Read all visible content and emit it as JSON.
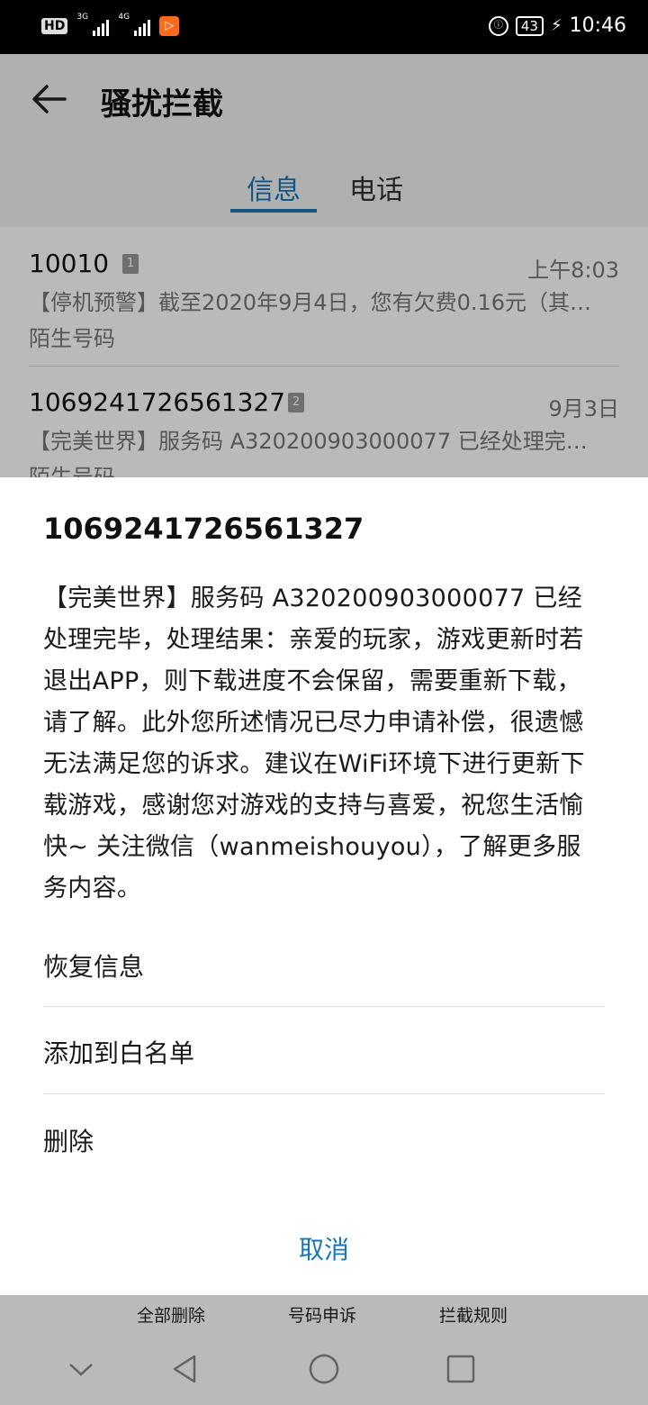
{
  "status_bar": {
    "hd_label": "HD",
    "sim1_label": "3G",
    "sim2_label": "4G",
    "app_badge": "▷",
    "battery": "43",
    "time": "10:46"
  },
  "app_bar": {
    "title": "骚扰拦截"
  },
  "tabs": [
    {
      "label": "信息",
      "active": true
    },
    {
      "label": "电话",
      "active": false
    }
  ],
  "messages": [
    {
      "number": "10010",
      "sim": "1",
      "time": "上午8:03",
      "snippet": "【停机预警】截至2020年9月4日，您有欠费0.16元（其…",
      "tag": "陌生号码"
    },
    {
      "number": "1069241726561327",
      "sim": "2",
      "time": "9月3日",
      "snippet": "【完美世界】服务码 A320200903000077 已经处理完…",
      "tag": "陌生号码"
    }
  ],
  "sheet": {
    "title": "1069241726561327",
    "body": "【完美世界】服务码 A320200903000077 已经处理完毕，处理结果：亲爱的玩家，游戏更新时若退出APP，则下载进度不会保留，需要重新下载，请了解。此外您所述情况已尽力申请补偿，很遗憾无法满足您的诉求。建议在WiFi环境下进行更新下载游戏，感谢您对游戏的支持与喜爱，祝您生活愉快~ 关注微信（wanmeishouyou），了解更多服务内容。",
    "options": [
      "恢复信息",
      "添加到白名单",
      "删除"
    ],
    "cancel": "取消"
  },
  "bottom_actions": [
    "全部删除",
    "号码申诉",
    "拦截规则"
  ],
  "colors": {
    "accent": "#1677b8",
    "scrim": "rgba(0,0,0,0.27)"
  }
}
